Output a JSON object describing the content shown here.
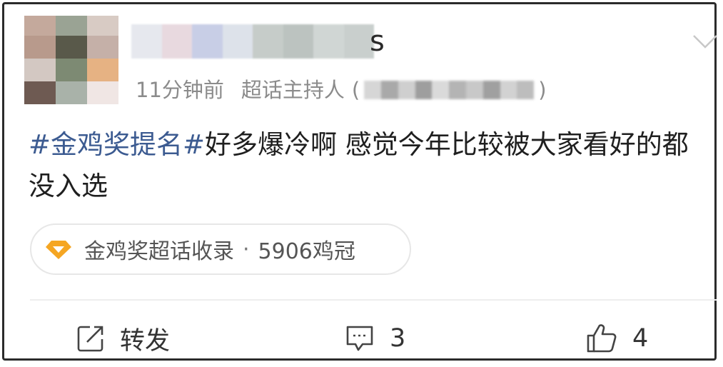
{
  "post": {
    "meta_time": "11分钟前",
    "meta_role": "超话主持人",
    "meta_paren_open": "(",
    "meta_paren_close": ")",
    "username_tail": "s",
    "hashtag": "#金鸡奖提名#",
    "body_text": "好多爆冷啊 感觉今年比较被大家看好的都没入选"
  },
  "topic_chip": {
    "name": "金鸡奖超话收录",
    "separator": "·",
    "count_text": "5906鸡冠",
    "icon": "diamond-icon",
    "icon_color": "#f5a623"
  },
  "actions": {
    "repost_label": "转发",
    "comment_count": "3",
    "like_count": "4"
  },
  "colors": {
    "hashtag": "#3c5b91",
    "meta_gray": "#8b8b8b",
    "border": "#2b2b2b"
  }
}
